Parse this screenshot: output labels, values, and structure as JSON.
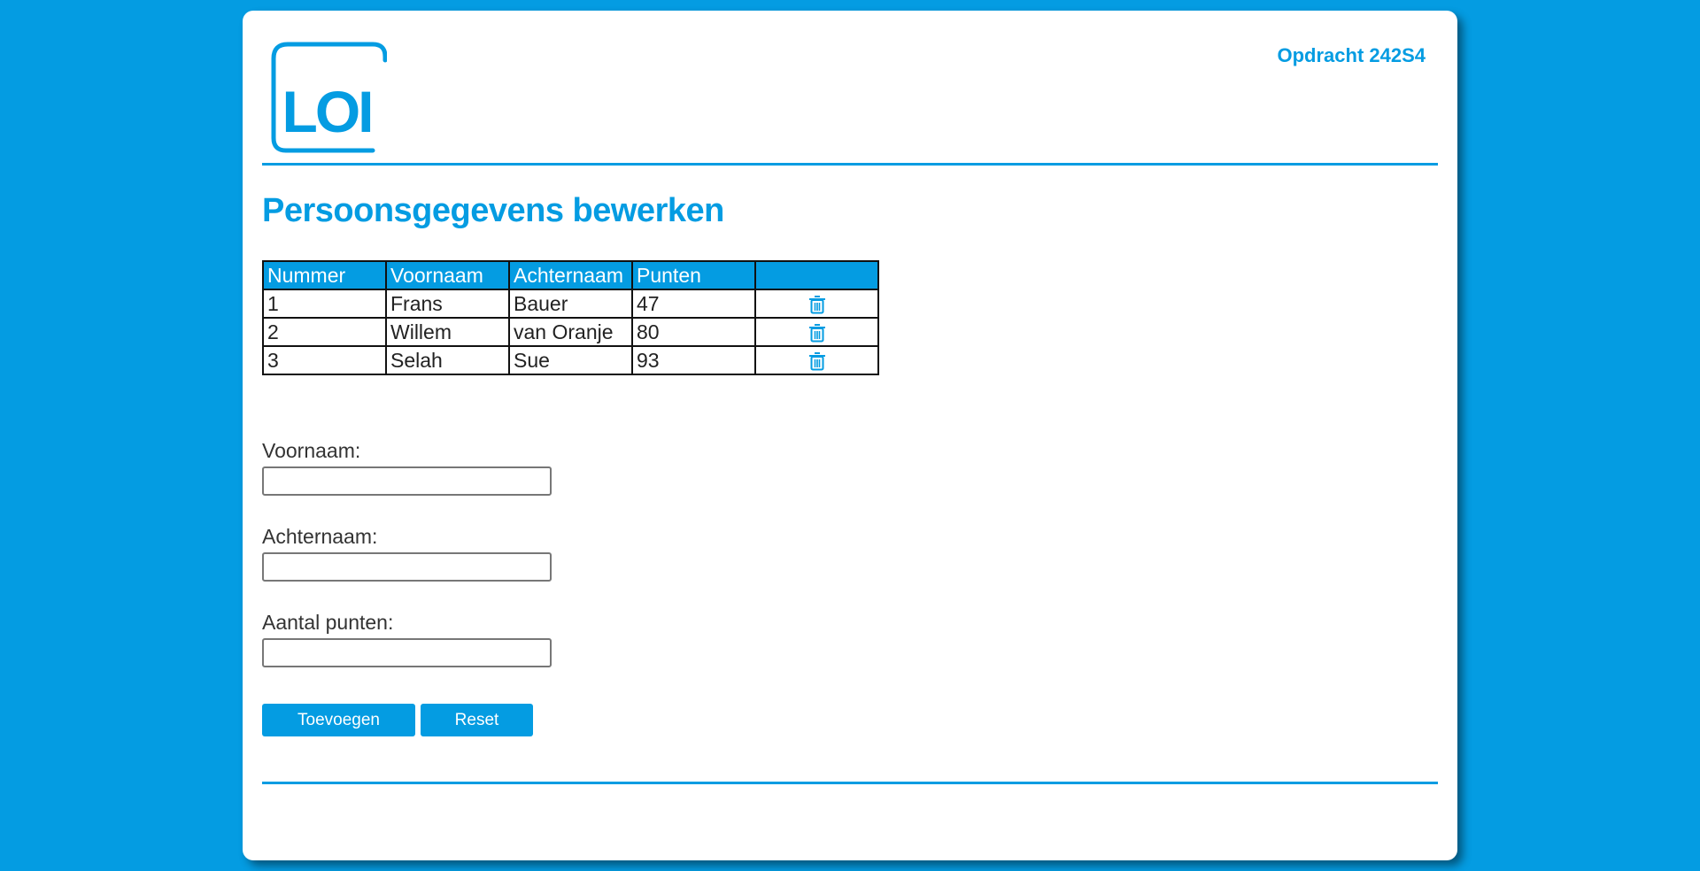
{
  "header": {
    "logo_text": "LOI",
    "assignment_label": "Opdracht 242S4"
  },
  "page_title": "Persoonsgegevens bewerken",
  "table": {
    "columns": [
      "Nummer",
      "Voornaam",
      "Achternaam",
      "Punten",
      ""
    ],
    "rows": [
      {
        "nummer": "1",
        "voornaam": "Frans",
        "achternaam": "Bauer",
        "punten": "47",
        "action_icon": "trash-icon"
      },
      {
        "nummer": "2",
        "voornaam": "Willem",
        "achternaam": "van Oranje",
        "punten": "80",
        "action_icon": "trash-icon"
      },
      {
        "nummer": "3",
        "voornaam": "Selah",
        "achternaam": "Sue",
        "punten": "93",
        "action_icon": "trash-icon"
      }
    ]
  },
  "form": {
    "first_name": {
      "label": "Voornaam:",
      "value": "",
      "placeholder": ""
    },
    "last_name": {
      "label": "Achternaam:",
      "value": "",
      "placeholder": ""
    },
    "points": {
      "label": "Aantal punten:",
      "value": "",
      "placeholder": ""
    },
    "add_button": "Toevoegen",
    "reset_button": "Reset"
  },
  "colors": {
    "accent": "#049ce2",
    "background": "#049ce2",
    "card": "#ffffff",
    "table_border": "#111111"
  }
}
